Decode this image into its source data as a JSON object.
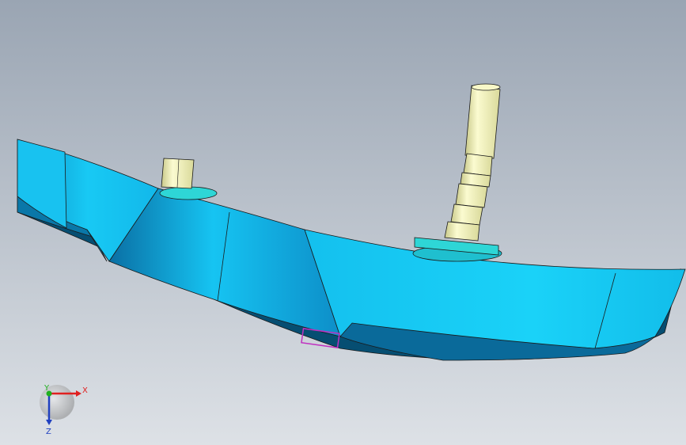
{
  "viewport": {
    "background_top": "#9aa5b3",
    "background_bottom": "#dde1e6"
  },
  "model": {
    "body_color": "#14c6f2",
    "body_shadow_color": "#0a77a8",
    "body_underside_color": "#064e72",
    "shaft_color": "#f4f4b8",
    "shaft_shadow_color": "#c9c98a",
    "collar_color": "#2ed6d6",
    "edge_color": "#1a1a1a",
    "marker_color": "#c030c0"
  },
  "triad": {
    "x_label": "X",
    "y_label": "Y",
    "z_label": "Z",
    "x_color": "#e02020",
    "y_color": "#20b020",
    "z_color": "#2040c0"
  }
}
